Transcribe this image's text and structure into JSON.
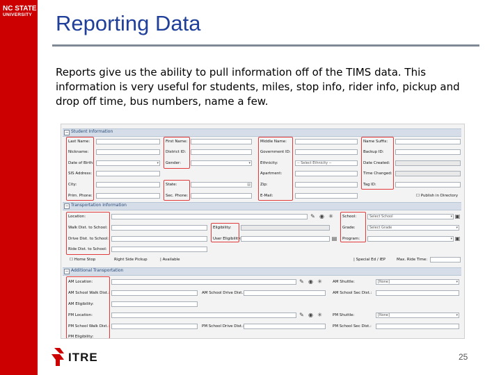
{
  "logo": {
    "line1": "NC STATE",
    "line2": "UNIVERSITY"
  },
  "slide": {
    "title": "Reporting Data",
    "body": "Reports give us the ability to pull information off of the TIMS data.  This information is very useful for students, miles, stop info, rider info, pickup and drop off time, bus numbers, name a few.",
    "page_number": "25"
  },
  "brand": {
    "itre": "ITRE",
    "sidebar_color": "#cc0000",
    "title_color": "#1f3f9a",
    "highlight_color": "#e23a3a"
  },
  "form": {
    "student_info": {
      "header": "Student Information",
      "labels": {
        "last_name": "Last Name:",
        "first_name": "First Name:",
        "middle_name": "Middle Name:",
        "name_suffix": "Name Suffix:",
        "nickname": "Nickname:",
        "district_id": "District ID:",
        "government_id": "Government ID:",
        "backup_id": "Backup ID:",
        "date_of_birth": "Date of Birth:",
        "gender": "Gender:",
        "ethnicity": "Ethnicity:",
        "date_created": "Date Created:",
        "sis_address": "SIS Address:",
        "apartment": "Apartment:",
        "time_changed": "Time Changed:",
        "city": "City:",
        "state": "State:",
        "zip": "Zip:",
        "tag_id": "Tag ID:",
        "prim_phone": "Prim. Phone:",
        "sec_phone": "Sec. Phone:",
        "email": "E-Mail:"
      },
      "ethnicity_value": "-- Select Ethnicity --",
      "publish_label": "Publish in Directory"
    },
    "transportation_info": {
      "header": "Transportation Information",
      "labels": {
        "location": "Location:",
        "walk_dist": "Walk Dist. to School:",
        "drive_dist": "Drive Dist. to School:",
        "ride_dist": "Ride Dist. to School:",
        "eligibility": "Eligibility:",
        "user_eligibility": "User Eligibility:",
        "school": "School:",
        "grade": "Grade:",
        "program": "Program:"
      },
      "school_value": "Select School",
      "grade_value": "Select Grade",
      "home_stop": "Home Stop",
      "right_side": "Right Side Pickup",
      "available": "Available",
      "special_ed": "Special Ed / IEP",
      "max_ride": "Max. Ride Time:"
    },
    "additional_transportation": {
      "header": "Additional Transportation",
      "labels": {
        "am_location": "AM Location:",
        "am_school_walk": "AM School Walk Dist.:",
        "am_school_drive": "AM School Drive Dist.:",
        "am_school_sec_dist": "AM School Sec Dist.:",
        "am_shuttle": "AM Shuttle:",
        "am_eligibility": "AM Eligibility:",
        "pm_location": "PM Location:",
        "pm_shuttle": "PM Shuttle:",
        "pm_school_walk": "PM School Walk Dist.:",
        "pm_school_drive": "PM School Drive Dist.:",
        "pm_school_sec_dist": "PM School Sec Dist.:",
        "pm_eligibility": "PM Eligibility:"
      },
      "am_shuttle_value": "[None]",
      "pm_shuttle_value": "[None]"
    }
  }
}
